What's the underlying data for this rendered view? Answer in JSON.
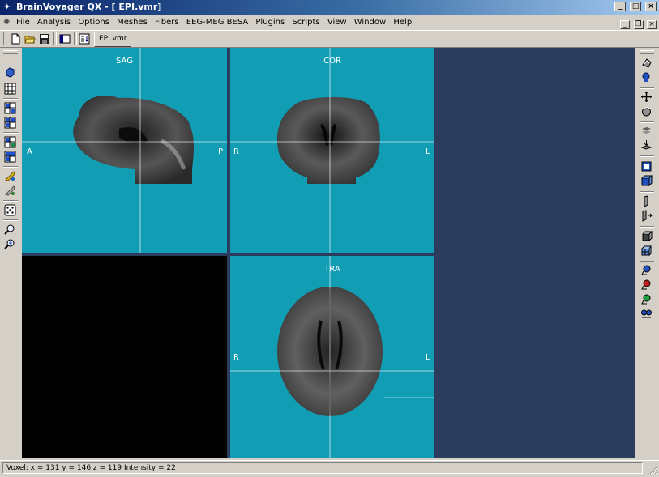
{
  "window": {
    "title": "BrainVoyager QX - [ EPI.vmr]",
    "minimize_glyph": "_",
    "maximize_glyph": "□",
    "close_glyph": "×"
  },
  "menubar": {
    "items": [
      "File",
      "Analysis",
      "Options",
      "Meshes",
      "Fibers",
      "EEG-MEG BESA",
      "Plugins",
      "Scripts",
      "View",
      "Window",
      "Help"
    ],
    "mdi_minimize_glyph": "_",
    "mdi_restore_glyph": "❐",
    "mdi_close_glyph": "×"
  },
  "toolbar": {
    "icons": [
      "new-document-icon",
      "open-folder-icon",
      "save-icon",
      "window-layout-icon",
      "list-sort-icon"
    ],
    "document_tab": "EPI.vmr"
  },
  "left_toolbar": {
    "icons": [
      "cube-icon",
      "grid-icon",
      "grid-small-icon",
      "grid-large-icon",
      "grid-multi-icon",
      "grid-compact-icon",
      "slice-yellow-icon",
      "slice-gray-icon",
      "dice-icon",
      "zoom-icon",
      "zoom-plus-icon"
    ]
  },
  "right_toolbar": {
    "icons": [
      "brain-3d-icon",
      "head-icon",
      "move-cross-icon",
      "rotate-icon",
      "slice-stack-icon",
      "slice-down-icon",
      "square-frame-icon",
      "cube-frame-icon",
      "slab-icon",
      "slab-arrow-icon",
      "box-3d-icon",
      "cube-wire-icon",
      "head-blue-icon",
      "head-red-icon",
      "head-green-icon",
      "head-pair-icon"
    ]
  },
  "views": {
    "sag": {
      "label": "SAG",
      "left": "A",
      "right": "P"
    },
    "cor": {
      "label": "COR",
      "left": "R",
      "right": "L"
    },
    "tra": {
      "label": "TRA",
      "left": "R",
      "right": "L"
    }
  },
  "status": {
    "text": "Voxel:  x = 131  y = 146  z = 119  Intensity = 22"
  },
  "colors": {
    "viewport_bg": "#2b3c5c",
    "slice_bg": "#119eb5",
    "title_gradient_start": "#0a246a",
    "chrome": "#d4d0c8"
  }
}
